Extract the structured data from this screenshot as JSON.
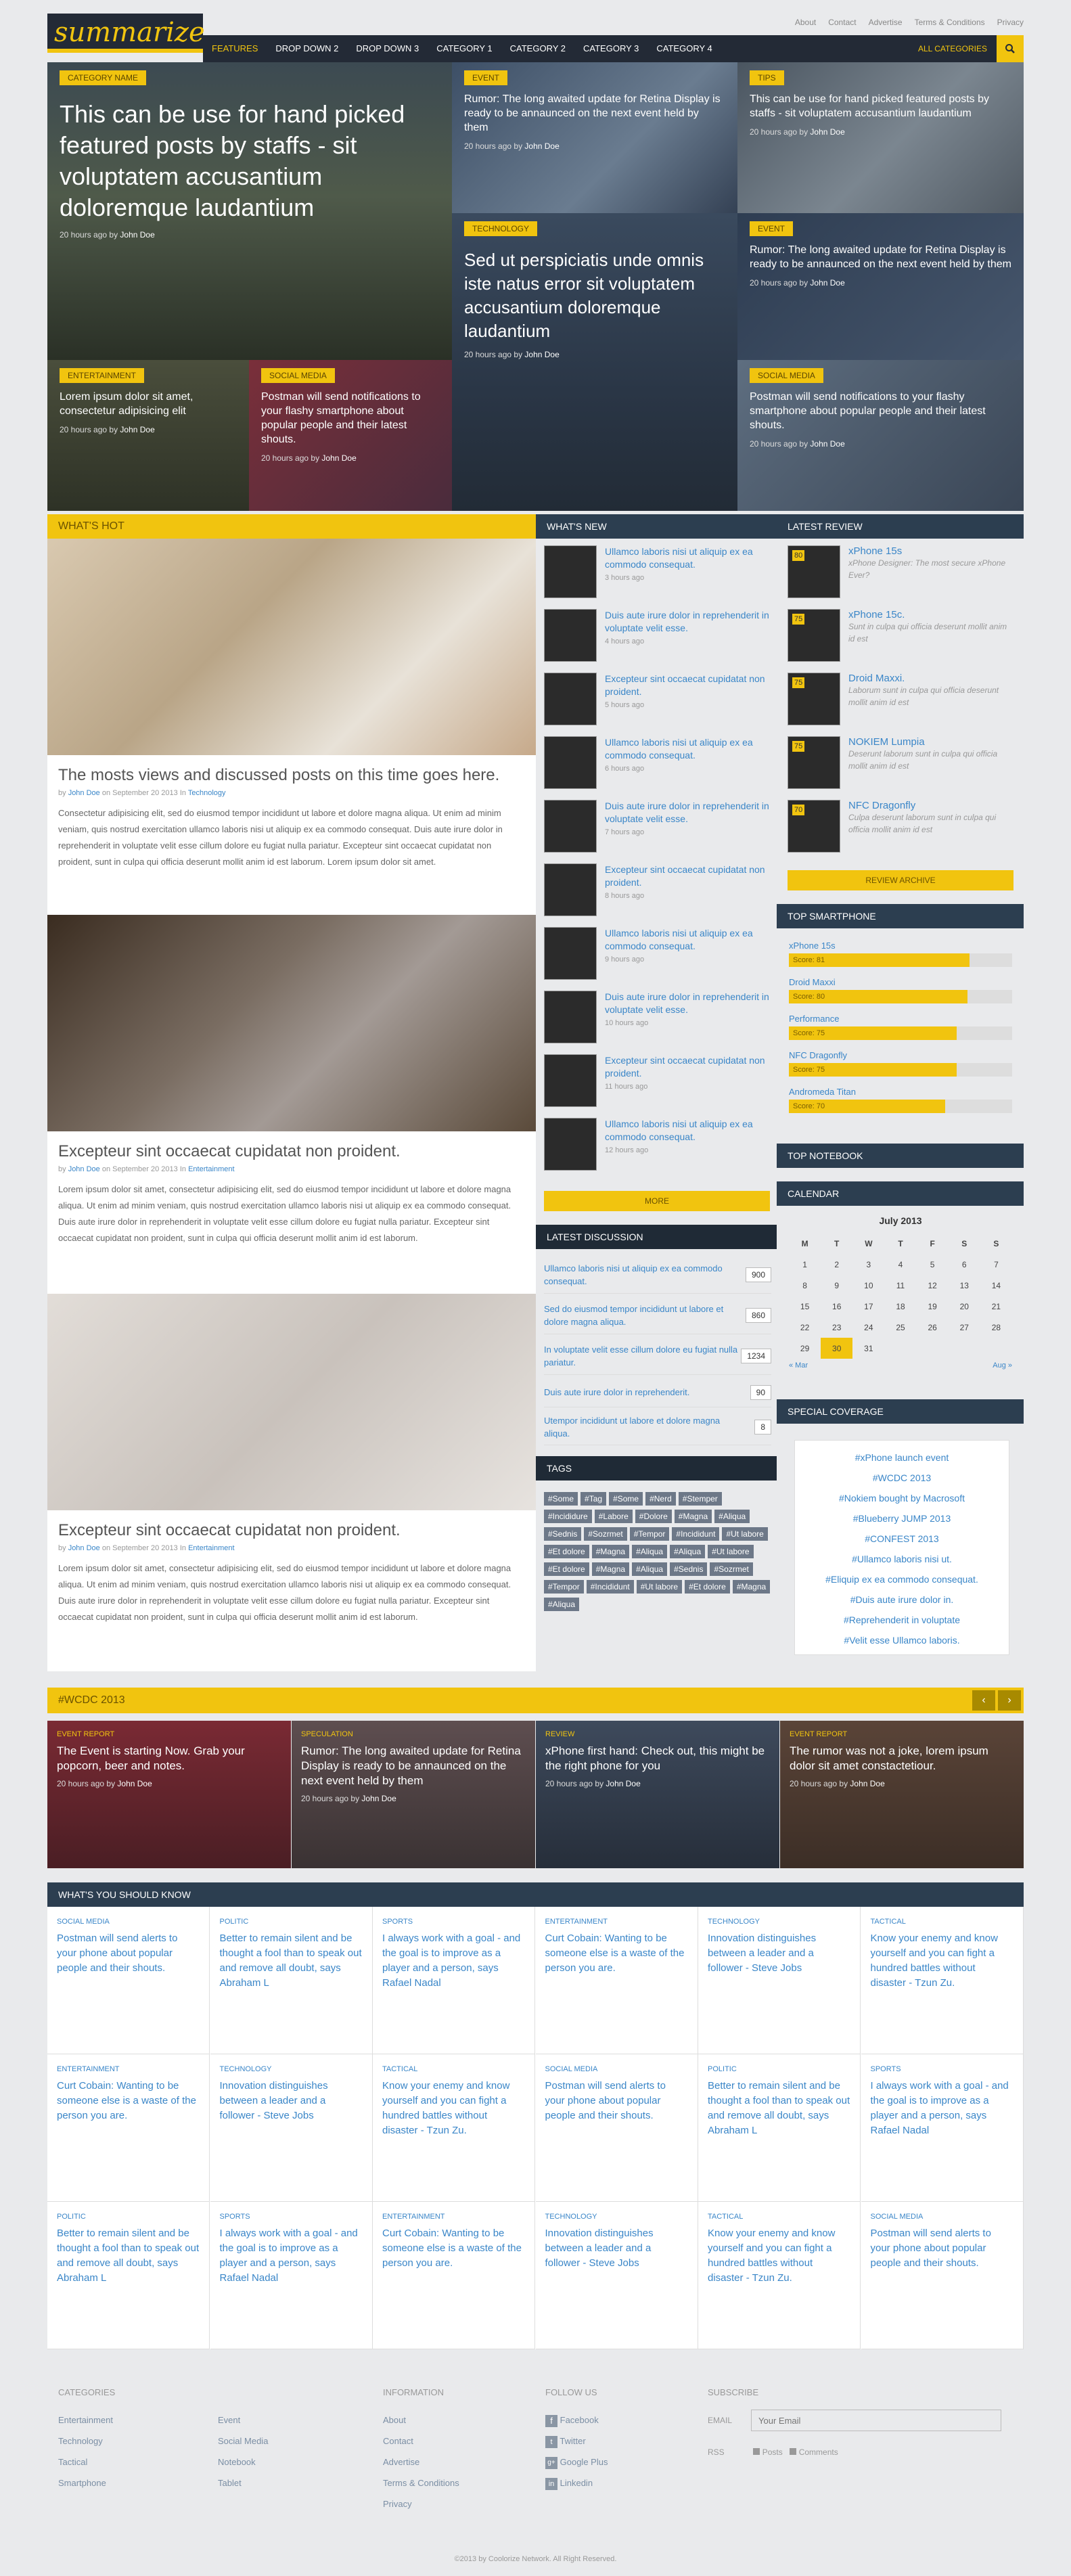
{
  "header": {
    "logo": "summarize",
    "topnav": [
      "About",
      "Contact",
      "Advertise",
      "Terms & Conditions",
      "Privacy"
    ],
    "nav": [
      "FEATURES",
      "DROP DOWN 2",
      "DROP DOWN 3",
      "CATEGORY 1",
      "CATEGORY 2",
      "CATEGORY 3",
      "CATEGORY 4"
    ],
    "all_categories": "ALL CATEGORIES"
  },
  "hero": {
    "main": {
      "tag": "CATEGORY NAME",
      "title": "This can be use for hand picked featured posts by staffs - sit voluptatem accusantium doloremque laudantium",
      "meta": "20 hours ago by",
      "author": "John Doe"
    },
    "t1": {
      "tag": "EVENT",
      "title": "Rumor: The long awaited update for Retina Display is ready to be annaunced on the next event held by them",
      "meta": "20 hours ago by",
      "author": "John Doe"
    },
    "t2": {
      "tag": "TIPS",
      "title": "This can be use for hand picked featured posts by staffs - sit voluptatem accusantium laudantium",
      "meta": "20 hours ago by",
      "author": "John Doe"
    },
    "t3": {
      "tag": "TECHNOLOGY",
      "title": "Sed ut perspiciatis unde omnis iste natus error sit voluptatem accusantium doloremque laudantium",
      "meta": "20 hours ago by",
      "author": "John Doe"
    },
    "t4": {
      "tag": "EVENT",
      "title": "Rumor: The long awaited update for Retina Display is ready to be annaunced on the next event held by them",
      "meta": "20 hours ago by",
      "author": "John Doe"
    },
    "t5": {
      "tag": "ENTERTAINMENT",
      "title": "Lorem ipsum dolor sit amet, consectetur adipisicing elit",
      "meta": "20 hours ago by",
      "author": "John Doe"
    },
    "t6": {
      "tag": "SOCIAL MEDIA",
      "title": "Postman will send notifications to your flashy smartphone about popular people and their latest shouts.",
      "meta": "20 hours ago by",
      "author": "John Doe"
    },
    "t7": {
      "tag": "SOCIAL MEDIA",
      "title": "Postman will send notifications to your flashy smartphone about popular people and their latest shouts.",
      "meta": "20 hours ago by",
      "author": "John Doe"
    }
  },
  "hot": {
    "title": "WHAT'S HOT",
    "posts": [
      {
        "title": "The mosts views and discussed posts on this time goes here.",
        "by": "by",
        "author": "John Doe",
        "on": "on September 20 2013 In",
        "cat": "Technology",
        "body": "Consectetur adipisicing elit, sed do eiusmod tempor incididunt ut labore et dolore magna aliqua. Ut enim ad minim veniam, quis nostrud exercitation ullamco laboris nisi ut aliquip ex ea commodo consequat. Duis aute irure dolor in reprehenderit in voluptate velit esse cillum dolore eu fugiat nulla pariatur. Excepteur sint occaecat cupidatat non proident, sunt in culpa qui officia deserunt mollit anim id est laborum. Lorem ipsum dolor sit amet."
      },
      {
        "title": "Excepteur sint occaecat cupidatat non proident.",
        "by": "by",
        "author": "John Doe",
        "on": "on September 20 2013 In",
        "cat": "Entertainment",
        "body": "Lorem ipsum dolor sit amet, consectetur adipisicing elit, sed do eiusmod tempor incididunt ut labore et dolore magna aliqua. Ut enim ad minim veniam, quis nostrud exercitation ullamco laboris nisi ut aliquip ex ea commodo consequat. Duis aute irure dolor in reprehenderit in voluptate velit esse cillum dolore eu fugiat nulla pariatur. Excepteur sint occaecat cupidatat non proident, sunt in culpa qui officia deserunt mollit anim id est laborum."
      },
      {
        "title": "Excepteur sint occaecat cupidatat non proident.",
        "by": "by",
        "author": "John Doe",
        "on": "on September 20 2013 In",
        "cat": "Entertainment",
        "body": "Lorem ipsum dolor sit amet, consectetur adipisicing elit, sed do eiusmod tempor incididunt ut labore et dolore magna aliqua. Ut enim ad minim veniam, quis nostrud exercitation ullamco laboris nisi ut aliquip ex ea commodo consequat. Duis aute irure dolor in reprehenderit in voluptate velit esse cillum dolore eu fugiat nulla pariatur. Excepteur sint occaecat cupidatat non proident, sunt in culpa qui officia deserunt mollit anim id est laborum."
      }
    ]
  },
  "whatsnew": {
    "title": "WHAT'S NEW",
    "items": [
      {
        "t": "Ullamco laboris nisi ut aliquip ex ea commodo consequat.",
        "tm": "3 hours ago"
      },
      {
        "t": "Duis aute irure dolor in reprehenderit in voluptate velit esse.",
        "tm": "4 hours ago"
      },
      {
        "t": "Excepteur sint occaecat cupidatat non proident.",
        "tm": "5 hours ago"
      },
      {
        "t": "Ullamco laboris nisi ut aliquip ex ea commodo consequat.",
        "tm": "6 hours ago"
      },
      {
        "t": "Duis aute irure dolor in reprehenderit in voluptate velit esse.",
        "tm": "7 hours ago"
      },
      {
        "t": "Excepteur sint occaecat cupidatat non proident.",
        "tm": "8 hours ago"
      },
      {
        "t": "Ullamco laboris nisi ut aliquip ex ea commodo consequat.",
        "tm": "9 hours ago"
      },
      {
        "t": "Duis aute irure dolor in reprehenderit in voluptate velit esse.",
        "tm": "10 hours ago"
      },
      {
        "t": "Excepteur sint occaecat cupidatat non proident.",
        "tm": "11 hours ago"
      },
      {
        "t": "Ullamco laboris nisi ut aliquip ex ea commodo consequat.",
        "tm": "12 hours ago"
      }
    ],
    "more": "MORE"
  },
  "discussion": {
    "title": "LATEST DISCUSSION",
    "items": [
      {
        "t": "Ullamco laboris nisi ut aliquip ex ea commodo consequat.",
        "c": "900"
      },
      {
        "t": "Sed do eiusmod tempor incididunt ut labore et dolore magna aliqua.",
        "c": "860"
      },
      {
        "t": "In voluptate velit esse cillum dolore eu fugiat nulla pariatur.",
        "c": "1234"
      },
      {
        "t": "Duis aute irure dolor in reprehenderit.",
        "c": "90"
      },
      {
        "t": "Utempor incididunt ut labore et dolore magna aliqua.",
        "c": "8"
      }
    ]
  },
  "tags": {
    "title": "TAGS",
    "items": [
      "#Some",
      "#Tag",
      "#Some",
      "#Nerd",
      "#Stemper",
      "#Incididure",
      "#Labore",
      "#Dolore",
      "#Magna",
      "#Aliqua",
      "#Sednis",
      "#Sozrmet",
      "#Tempor",
      "#Incididunt",
      "#Ut labore",
      "#Et dolore",
      "#Magna",
      "#Aliqua",
      "#Aliqua",
      "#Ut labore",
      "#Et dolore",
      "#Magna",
      "#Aliqua",
      "#Sednis",
      "#Sozrmet",
      "#Tempor",
      "#Incididunt",
      "#Ut labore",
      "#Et dolore",
      "#Magna",
      "#Aliqua"
    ]
  },
  "review": {
    "title": "LATEST REVIEW",
    "items": [
      {
        "t": "xPhone 15s",
        "d": "xPhone Designer: The most secure xPhone Ever?",
        "score": "80"
      },
      {
        "t": "xPhone 15c.",
        "d": "Sunt in culpa qui officia deserunt mollit anim id est",
        "score": "75"
      },
      {
        "t": "Droid Maxxi.",
        "d": "Laborum sunt in culpa qui officia deserunt mollit anim id est",
        "score": "75"
      },
      {
        "t": "NOKIEM Lumpia",
        "d": "Deserunt laborum sunt in culpa qui officia mollit anim id est",
        "score": "75"
      },
      {
        "t": "NFC Dragonfly",
        "d": "Culpa deserunt laborum sunt in culpa qui officia mollit anim id est",
        "score": "70"
      }
    ],
    "archive": "REVIEW ARCHIVE"
  },
  "smartphone": {
    "title": "TOP SMARTPHONE",
    "items": [
      {
        "n": "xPhone 15s",
        "label": "Score: 81",
        "v": 0.81
      },
      {
        "n": "Droid Maxxi",
        "label": "Score: 80",
        "v": 0.8
      },
      {
        "n": "Performance",
        "label": "Score: 75",
        "v": 0.75
      },
      {
        "n": "NFC Dragonfly",
        "label": "Score: 75",
        "v": 0.75
      },
      {
        "n": "Andromeda Titan",
        "label": "Score: 70",
        "v": 0.7
      }
    ]
  },
  "notebook": {
    "title": "TOP NOTEBOOK"
  },
  "calendar": {
    "title": "CALENDAR",
    "month": "July 2013",
    "days": [
      "M",
      "T",
      "W",
      "T",
      "F",
      "S",
      "S"
    ],
    "weeks": [
      [
        "1",
        "2",
        "3",
        "4",
        "5",
        "6",
        "7"
      ],
      [
        "8",
        "9",
        "10",
        "11",
        "12",
        "13",
        "14"
      ],
      [
        "15",
        "16",
        "17",
        "18",
        "19",
        "20",
        "21"
      ],
      [
        "22",
        "23",
        "24",
        "25",
        "26",
        "27",
        "28"
      ],
      [
        "29",
        "30",
        "31",
        "",
        "",
        "",
        ""
      ]
    ],
    "prev": "« Mar",
    "next": "Aug »"
  },
  "coverage": {
    "title": "SPECIAL COVERAGE",
    "items": [
      "#xPhone launch event",
      "#WCDC 2013",
      "#Nokiem bought by Macrosoft",
      "#Blueberry JUMP 2013",
      "#CONFEST 2013",
      "#Ullamco laboris nisi ut.",
      "#Eliquip ex ea commodo consequat.",
      "#Duis aute irure dolor in.",
      "#Reprehenderit in voluptate",
      "#Velit esse Ullamco laboris."
    ]
  },
  "wcdc": {
    "title": "#WCDC 2013",
    "items": [
      {
        "tag": "EVENT REPORT",
        "t": "The Event is starting Now. Grab your popcorn, beer and notes.",
        "meta": "20 hours ago by",
        "author": "John Doe"
      },
      {
        "tag": "SPECULATION",
        "t": "Rumor: The long awaited update for Retina Display is ready to be annaunced on the next event held by them",
        "meta": "20 hours ago by",
        "author": "John Doe"
      },
      {
        "tag": "REVIEW",
        "t": "xPhone first hand: Check out, this might be the right phone for you",
        "meta": "20 hours ago by",
        "author": "John Doe"
      },
      {
        "tag": "EVENT REPORT",
        "t": "The rumor was not a joke, lorem ipsum dolor sit amet constactetiour.",
        "meta": "20 hours ago by",
        "author": "John Doe"
      }
    ]
  },
  "know": {
    "title": "WHAT'S YOU SHOULD KNOW",
    "rows": [
      [
        {
          "c": "SOCIAL MEDIA",
          "t": "Postman will send alerts to your phone about popular people and their shouts."
        },
        {
          "c": "POLITIC",
          "t": "Better to remain silent and be thought a fool than to speak out and remove all doubt, says Abraham L"
        },
        {
          "c": "SPORTS",
          "t": "I always work with a goal - and the goal is to improve as a player and a person, says Rafael Nadal"
        },
        {
          "c": "ENTERTAINMENT",
          "t": "Curt Cobain: Wanting to be someone else is a waste of the person you are."
        },
        {
          "c": "TECHNOLOGY",
          "t": "Innovation distinguishes between a leader and a follower - Steve Jobs"
        },
        {
          "c": "TACTICAL",
          "t": "Know your enemy and know yourself and you can fight a hundred battles without disaster - Tzun Zu."
        }
      ],
      [
        {
          "c": "ENTERTAINMENT",
          "t": "Curt Cobain: Wanting to be someone else is a waste of the person you are."
        },
        {
          "c": "TECHNOLOGY",
          "t": "Innovation distinguishes between a leader and a follower - Steve Jobs"
        },
        {
          "c": "TACTICAL",
          "t": "Know your enemy and know yourself and you can fight a hundred battles without disaster - Tzun Zu."
        },
        {
          "c": "SOCIAL MEDIA",
          "t": "Postman will send alerts to your phone about popular people and their shouts."
        },
        {
          "c": "POLITIC",
          "t": "Better to remain silent and be thought a fool than to speak out and remove all doubt, says Abraham L"
        },
        {
          "c": "SPORTS",
          "t": "I always work with a goal - and the goal is to improve as a player and a person, says Rafael Nadal"
        }
      ],
      [
        {
          "c": "POLITIC",
          "t": "Better to remain silent and be thought a fool than to speak out and remove all doubt, says Abraham L"
        },
        {
          "c": "SPORTS",
          "t": "I always work with a goal - and the goal is to improve as a player and a person, says Rafael Nadal"
        },
        {
          "c": "ENTERTAINMENT",
          "t": "Curt Cobain: Wanting to be someone else is a waste of the person you are."
        },
        {
          "c": "TECHNOLOGY",
          "t": "Innovation distinguishes between a leader and a follower - Steve Jobs"
        },
        {
          "c": "TACTICAL",
          "t": "Know your enemy and know yourself and you can fight a hundred battles without disaster - Tzun Zu."
        },
        {
          "c": "SOCIAL MEDIA",
          "t": "Postman will send alerts to your phone about popular people and their shouts."
        }
      ]
    ]
  },
  "footer": {
    "categories_title": "CATEGORIES",
    "cats_a": [
      "Entertainment",
      "Technology",
      "Tactical",
      "Smartphone"
    ],
    "cats_b": [
      "Event",
      "Social Media",
      "Notebook",
      "Tablet"
    ],
    "info_title": "INFORMATION",
    "info": [
      "About",
      "Contact",
      "Advertise",
      "Terms & Conditions",
      "Privacy"
    ],
    "follow_title": "FOLLOW US",
    "follow": [
      "Facebook",
      "Twitter",
      "Google Plus",
      "Linkedin"
    ],
    "subscribe_title": "SUBSCRIBE",
    "email_label": "EMAIL",
    "email_placeholder": "Your Email",
    "rss_label": "RSS",
    "rss_posts": "Posts",
    "rss_comments": "Comments",
    "copyright": "©2013 by Coolorize Network. All Right Reserved."
  }
}
